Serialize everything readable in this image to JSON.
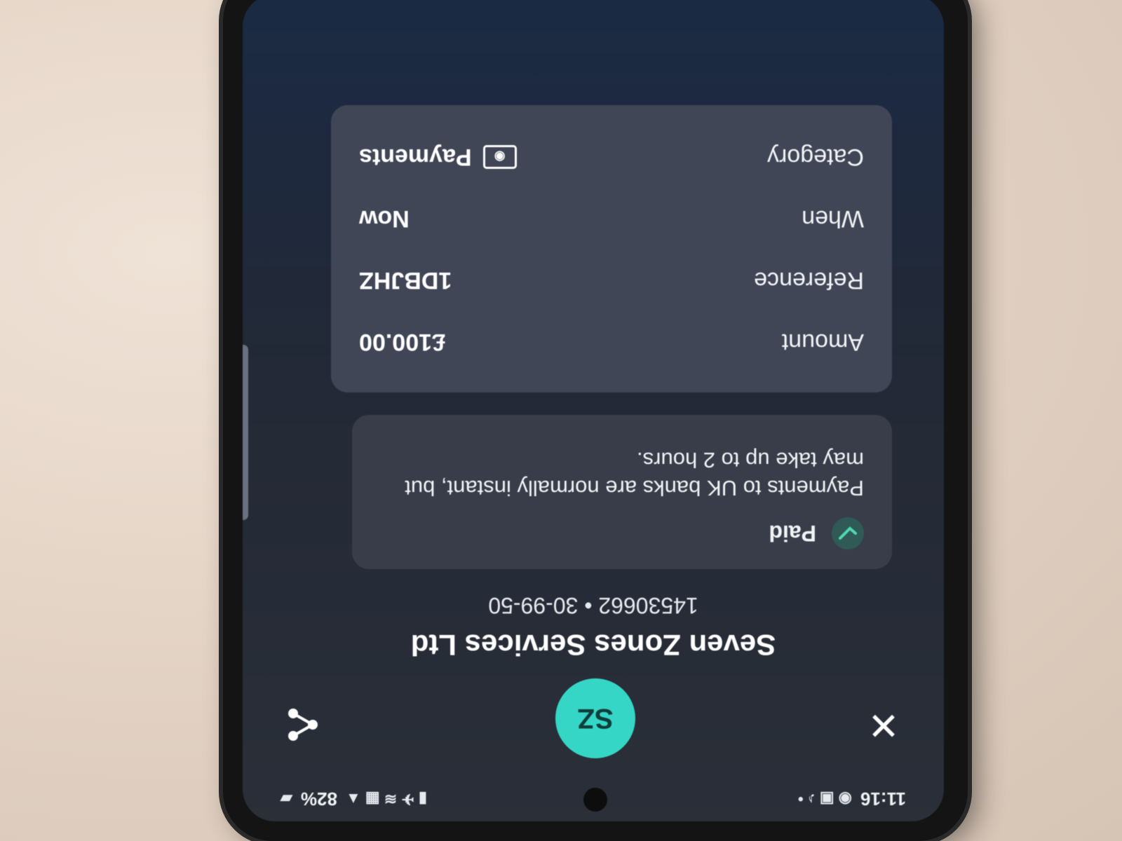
{
  "status_bar": {
    "time": "11:16",
    "battery": "82%"
  },
  "payee": {
    "initials": "SZ",
    "name": "Seven Zones Services Ltd",
    "account": "14530662 • 30-99-50"
  },
  "status": {
    "label": "Paid",
    "note": "Payments to UK banks are normally instant, but may take up to 2 hours."
  },
  "details": {
    "rows": [
      {
        "label": "Amount",
        "value": "£100.00"
      },
      {
        "label": "Reference",
        "value": "1DBJHZ"
      },
      {
        "label": "When",
        "value": "Now"
      },
      {
        "label": "Category",
        "value": "Payments"
      }
    ]
  },
  "icons": {
    "close": "close-icon",
    "share": "share-icon",
    "check": "check-icon",
    "category": "cash-icon"
  },
  "colors": {
    "avatar": "#36d6c6",
    "check": "#4fd9b0",
    "card": "#404656"
  }
}
